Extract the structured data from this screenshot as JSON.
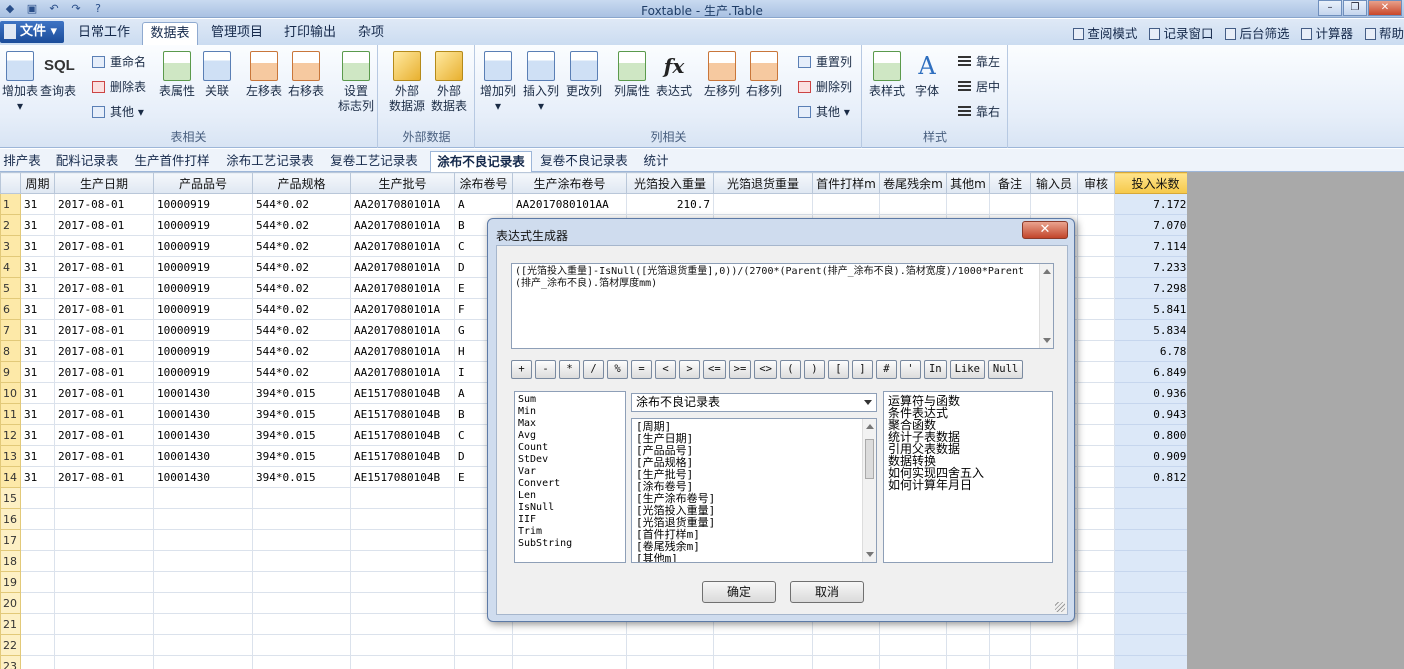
{
  "window": {
    "title": "Foxtable - 生产.Table"
  },
  "file_menu": {
    "label": "文件"
  },
  "ribbon_tabs": [
    "日常工作",
    "数据表",
    "管理项目",
    "打印输出",
    "杂项"
  ],
  "right_links": [
    "查阅模式",
    "记录窗口",
    "后台筛选",
    "计算器",
    "帮助"
  ],
  "ribbon": {
    "add_table": "增加表",
    "query_table": "查询表",
    "rename": "重命名",
    "delete_table": "删除表",
    "other1": "其他",
    "table_props": "表属性",
    "relation": "关联",
    "move_left": "左移表",
    "move_right": "右移表",
    "set_flag_line1": "设置",
    "set_flag_line2": "标志列",
    "group_table": "表相关",
    "ext_source_line1": "外部",
    "ext_source_line2": "数据源",
    "ext_table_line1": "外部",
    "ext_table_line2": "数据表",
    "group_external": "外部数据",
    "add_col": "增加列",
    "insert_col": "插入列",
    "change_col": "更改列",
    "reset_col": "重置列",
    "delete_col": "删除列",
    "other2": "其他",
    "col_props": "列属性",
    "expression": "表达式",
    "col_left": "左移列",
    "col_right": "右移列",
    "group_column": "列相关",
    "table_style": "表样式",
    "font": "字体",
    "align_left": "靠左",
    "align_center": "居中",
    "align_right": "靠右",
    "group_style": "样式"
  },
  "sheet_tabs": [
    "排产表",
    "配料记录表",
    "生产首件打样",
    "涂布工艺记录表",
    "复卷工艺记录表",
    "涂布不良记录表",
    "复卷不良记录表",
    "统计"
  ],
  "active_sheet": "涂布不良记录表",
  "grid": {
    "columns": [
      "周期",
      "生产日期",
      "产品品号",
      "产品规格",
      "生产批号",
      "涂布卷号",
      "生产涂布卷号",
      "光箔投入重量",
      "光箔退货重量",
      "首件打样m",
      "卷尾残余m",
      "其他m",
      "备注",
      "输入员",
      "审核",
      "投入米数"
    ],
    "rows": [
      {
        "n": "1",
        "cells": [
          "31",
          "2017-08-01",
          "10000919",
          "544*0.02",
          "AA2017080101A",
          "A",
          "AA2017080101AA",
          "210.7",
          "",
          "",
          "",
          "",
          "",
          "",
          "",
          "7.1725"
        ]
      },
      {
        "n": "2",
        "cells": [
          "31",
          "2017-08-01",
          "10000919",
          "544*0.02",
          "AA2017080101A",
          "B",
          "",
          "",
          "",
          "",
          "",
          "",
          "",
          "",
          "",
          "7.0704"
        ]
      },
      {
        "n": "3",
        "cells": [
          "31",
          "2017-08-01",
          "10000919",
          "544*0.02",
          "AA2017080101A",
          "C",
          "",
          "",
          "",
          "",
          "",
          "",
          "",
          "",
          "",
          "7.1147"
        ]
      },
      {
        "n": "4",
        "cells": [
          "31",
          "2017-08-01",
          "10000919",
          "544*0.02",
          "AA2017080101A",
          "D",
          "",
          "",
          "",
          "",
          "",
          "",
          "",
          "",
          "",
          "7.2338"
        ]
      },
      {
        "n": "5",
        "cells": [
          "31",
          "2017-08-01",
          "10000919",
          "544*0.02",
          "AA2017080101A",
          "E",
          "",
          "",
          "",
          "",
          "",
          "",
          "",
          "",
          "",
          "7.2985"
        ]
      },
      {
        "n": "6",
        "cells": [
          "31",
          "2017-08-01",
          "10000919",
          "544*0.02",
          "AA2017080101A",
          "F",
          "",
          "",
          "",
          "",
          "",
          "",
          "",
          "",
          "",
          "5.8415"
        ]
      },
      {
        "n": "7",
        "cells": [
          "31",
          "2017-08-01",
          "10000919",
          "544*0.02",
          "AA2017080101A",
          "G",
          "",
          "",
          "",
          "",
          "",
          "",
          "",
          "",
          "",
          "5.8347"
        ]
      },
      {
        "n": "8",
        "cells": [
          "31",
          "2017-08-01",
          "10000919",
          "544*0.02",
          "AA2017080101A",
          "H",
          "",
          "",
          "",
          "",
          "",
          "",
          "",
          "",
          "",
          "6.781"
        ]
      },
      {
        "n": "9",
        "cells": [
          "31",
          "2017-08-01",
          "10000919",
          "544*0.02",
          "AA2017080101A",
          "I",
          "",
          "",
          "",
          "",
          "",
          "",
          "",
          "",
          "",
          "6.8491"
        ]
      },
      {
        "n": "10",
        "cells": [
          "31",
          "2017-08-01",
          "10001430",
          "394*0.015",
          "AE1517080104B",
          "A",
          "",
          "",
          "",
          "",
          "",
          "",
          "",
          "",
          "",
          "0.9369"
        ]
      },
      {
        "n": "11",
        "cells": [
          "31",
          "2017-08-01",
          "10001430",
          "394*0.015",
          "AE1517080104B",
          "B",
          "",
          "",
          "",
          "",
          "",
          "",
          "",
          "",
          "",
          "0.9438"
        ]
      },
      {
        "n": "12",
        "cells": [
          "31",
          "2017-08-01",
          "10001430",
          "394*0.015",
          "AE1517080104B",
          "C",
          "",
          "",
          "",
          "",
          "",
          "",
          "",
          "",
          "",
          "0.8006"
        ]
      },
      {
        "n": "13",
        "cells": [
          "31",
          "2017-08-01",
          "10001430",
          "394*0.015",
          "AE1517080104B",
          "D",
          "",
          "",
          "",
          "",
          "",
          "",
          "",
          "",
          "",
          "0.9099"
        ]
      },
      {
        "n": "14",
        "cells": [
          "31",
          "2017-08-01",
          "10001430",
          "394*0.015",
          "AE1517080104B",
          "E",
          "",
          "",
          "",
          "",
          "",
          "",
          "",
          "",
          "",
          "0.8128"
        ]
      }
    ],
    "empty_rows": [
      "15",
      "16",
      "17",
      "18",
      "19",
      "20",
      "21",
      "22",
      "23"
    ]
  },
  "dialog": {
    "title": "表达式生成器",
    "close_label": "✕",
    "expression": "([光箔投入重量]-IsNull([光箔退货重量],0))/(2700*(Parent(排产_涂布不良).箔材宽度)/1000*Parent(排产_涂布不良).箔材厚度mm)",
    "operators": [
      "+",
      "-",
      "*",
      "/",
      "%",
      "=",
      "<",
      ">",
      "<=",
      ">=",
      "<>",
      "(",
      ")",
      "[",
      "]",
      "#",
      "'",
      "In",
      "Like",
      "Null"
    ],
    "functions": [
      "Sum",
      "Min",
      "Max",
      "Avg",
      "Count",
      "StDev",
      "Var",
      "Convert",
      "Len",
      "IsNull",
      "IIF",
      "Trim",
      "SubString"
    ],
    "table_select": "涂布不良记录表",
    "fields": [
      "[周期]",
      "[生产日期]",
      "[产品品号]",
      "[产品规格]",
      "[生产批号]",
      "[涂布卷号]",
      "[生产涂布卷号]",
      "[光箔投入重量]",
      "[光箔退货重量]",
      "[首件打样m]",
      "[卷尾残余m]",
      "[其他m]"
    ],
    "help_items": [
      "运算符与函数",
      "条件表达式",
      "聚合函数",
      "统计子表数据",
      "引用父表数据",
      "数据转换",
      "如何实现四舍五入",
      "如何计算年月日"
    ],
    "ok_label": "确定",
    "cancel_label": "取消"
  },
  "colors": {
    "ribbon_bg": "#e6eef9",
    "row_header": "#fde9a8",
    "highlight_col": "#dce8f8",
    "dialog_frame": "#cfdcee"
  }
}
